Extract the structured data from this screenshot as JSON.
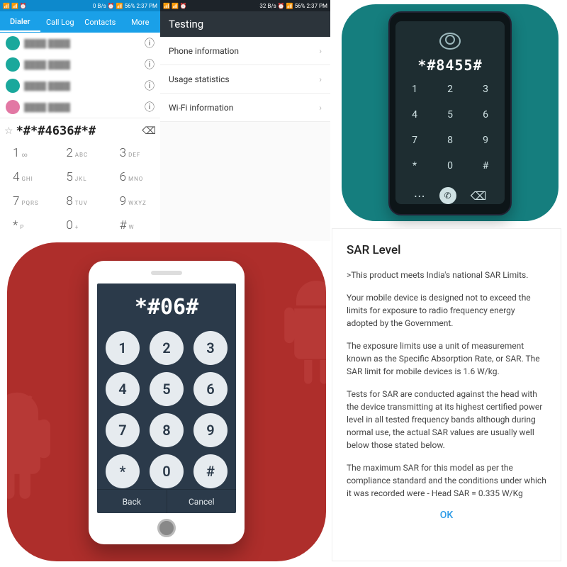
{
  "dialer": {
    "status": {
      "net": "0 B/s",
      "batt": "56%",
      "time": "2:37 PM"
    },
    "tabs": [
      "Dialer",
      "Call Log",
      "Contacts",
      "More"
    ],
    "active_tab": 0,
    "contacts": [
      {
        "avatar": "g",
        "name": "contact"
      },
      {
        "avatar": "g",
        "name": "contact"
      },
      {
        "avatar": "g",
        "name": "contact"
      },
      {
        "avatar": "p",
        "name": "contact"
      }
    ],
    "dialed": "*#*#4636#*#",
    "keys": [
      {
        "n": "1",
        "s": "∞"
      },
      {
        "n": "2",
        "s": "ABC"
      },
      {
        "n": "3",
        "s": "DEF"
      },
      {
        "n": "4",
        "s": "GHI"
      },
      {
        "n": "5",
        "s": "JKL"
      },
      {
        "n": "6",
        "s": "MNO"
      },
      {
        "n": "7",
        "s": "PQRS"
      },
      {
        "n": "8",
        "s": "TUV"
      },
      {
        "n": "9",
        "s": "WXYZ"
      },
      {
        "n": "*",
        "s": "P"
      },
      {
        "n": "0",
        "s": "+"
      },
      {
        "n": "#",
        "s": "W"
      }
    ]
  },
  "testing": {
    "status": {
      "net": "32 B/s",
      "batt": "56%",
      "time": "2:37 PM"
    },
    "title": "Testing",
    "rows": [
      "Phone information",
      "Usage statistics",
      "Wi-Fi information"
    ]
  },
  "teal": {
    "code": "*#8455#",
    "keys": [
      "1",
      "2",
      "3",
      "4",
      "5",
      "6",
      "7",
      "8",
      "9",
      "*",
      "0",
      "#"
    ]
  },
  "red": {
    "code": "*#06#",
    "keys": [
      "1",
      "2",
      "3",
      "4",
      "5",
      "6",
      "7",
      "8",
      "9",
      "*",
      "0",
      "#"
    ],
    "back": "Back",
    "cancel": "Cancel"
  },
  "sar": {
    "title": "SAR Level",
    "p1": ">This product meets India's national SAR Limits.",
    "p2": "Your mobile device is designed not to exceed the limits for exposure to radio frequency energy adopted by the Government.",
    "p3": "The exposure limits use a unit of measurement known as the Specific Absorption Rate, or SAR. The SAR limit for mobile devices is 1.6 W/kg.",
    "p4": "Tests for SAR are conducted against the head with the device transmitting at its highest certified power level in all tested frequency bands although during normal use, the actual SAR values are usually well below those stated below.",
    "p5": "The maximum SAR for this model as per the compliance standard and the conditions under which it was recorded were -  Head SAR = 0.335 W/Kg",
    "ok": "OK"
  }
}
